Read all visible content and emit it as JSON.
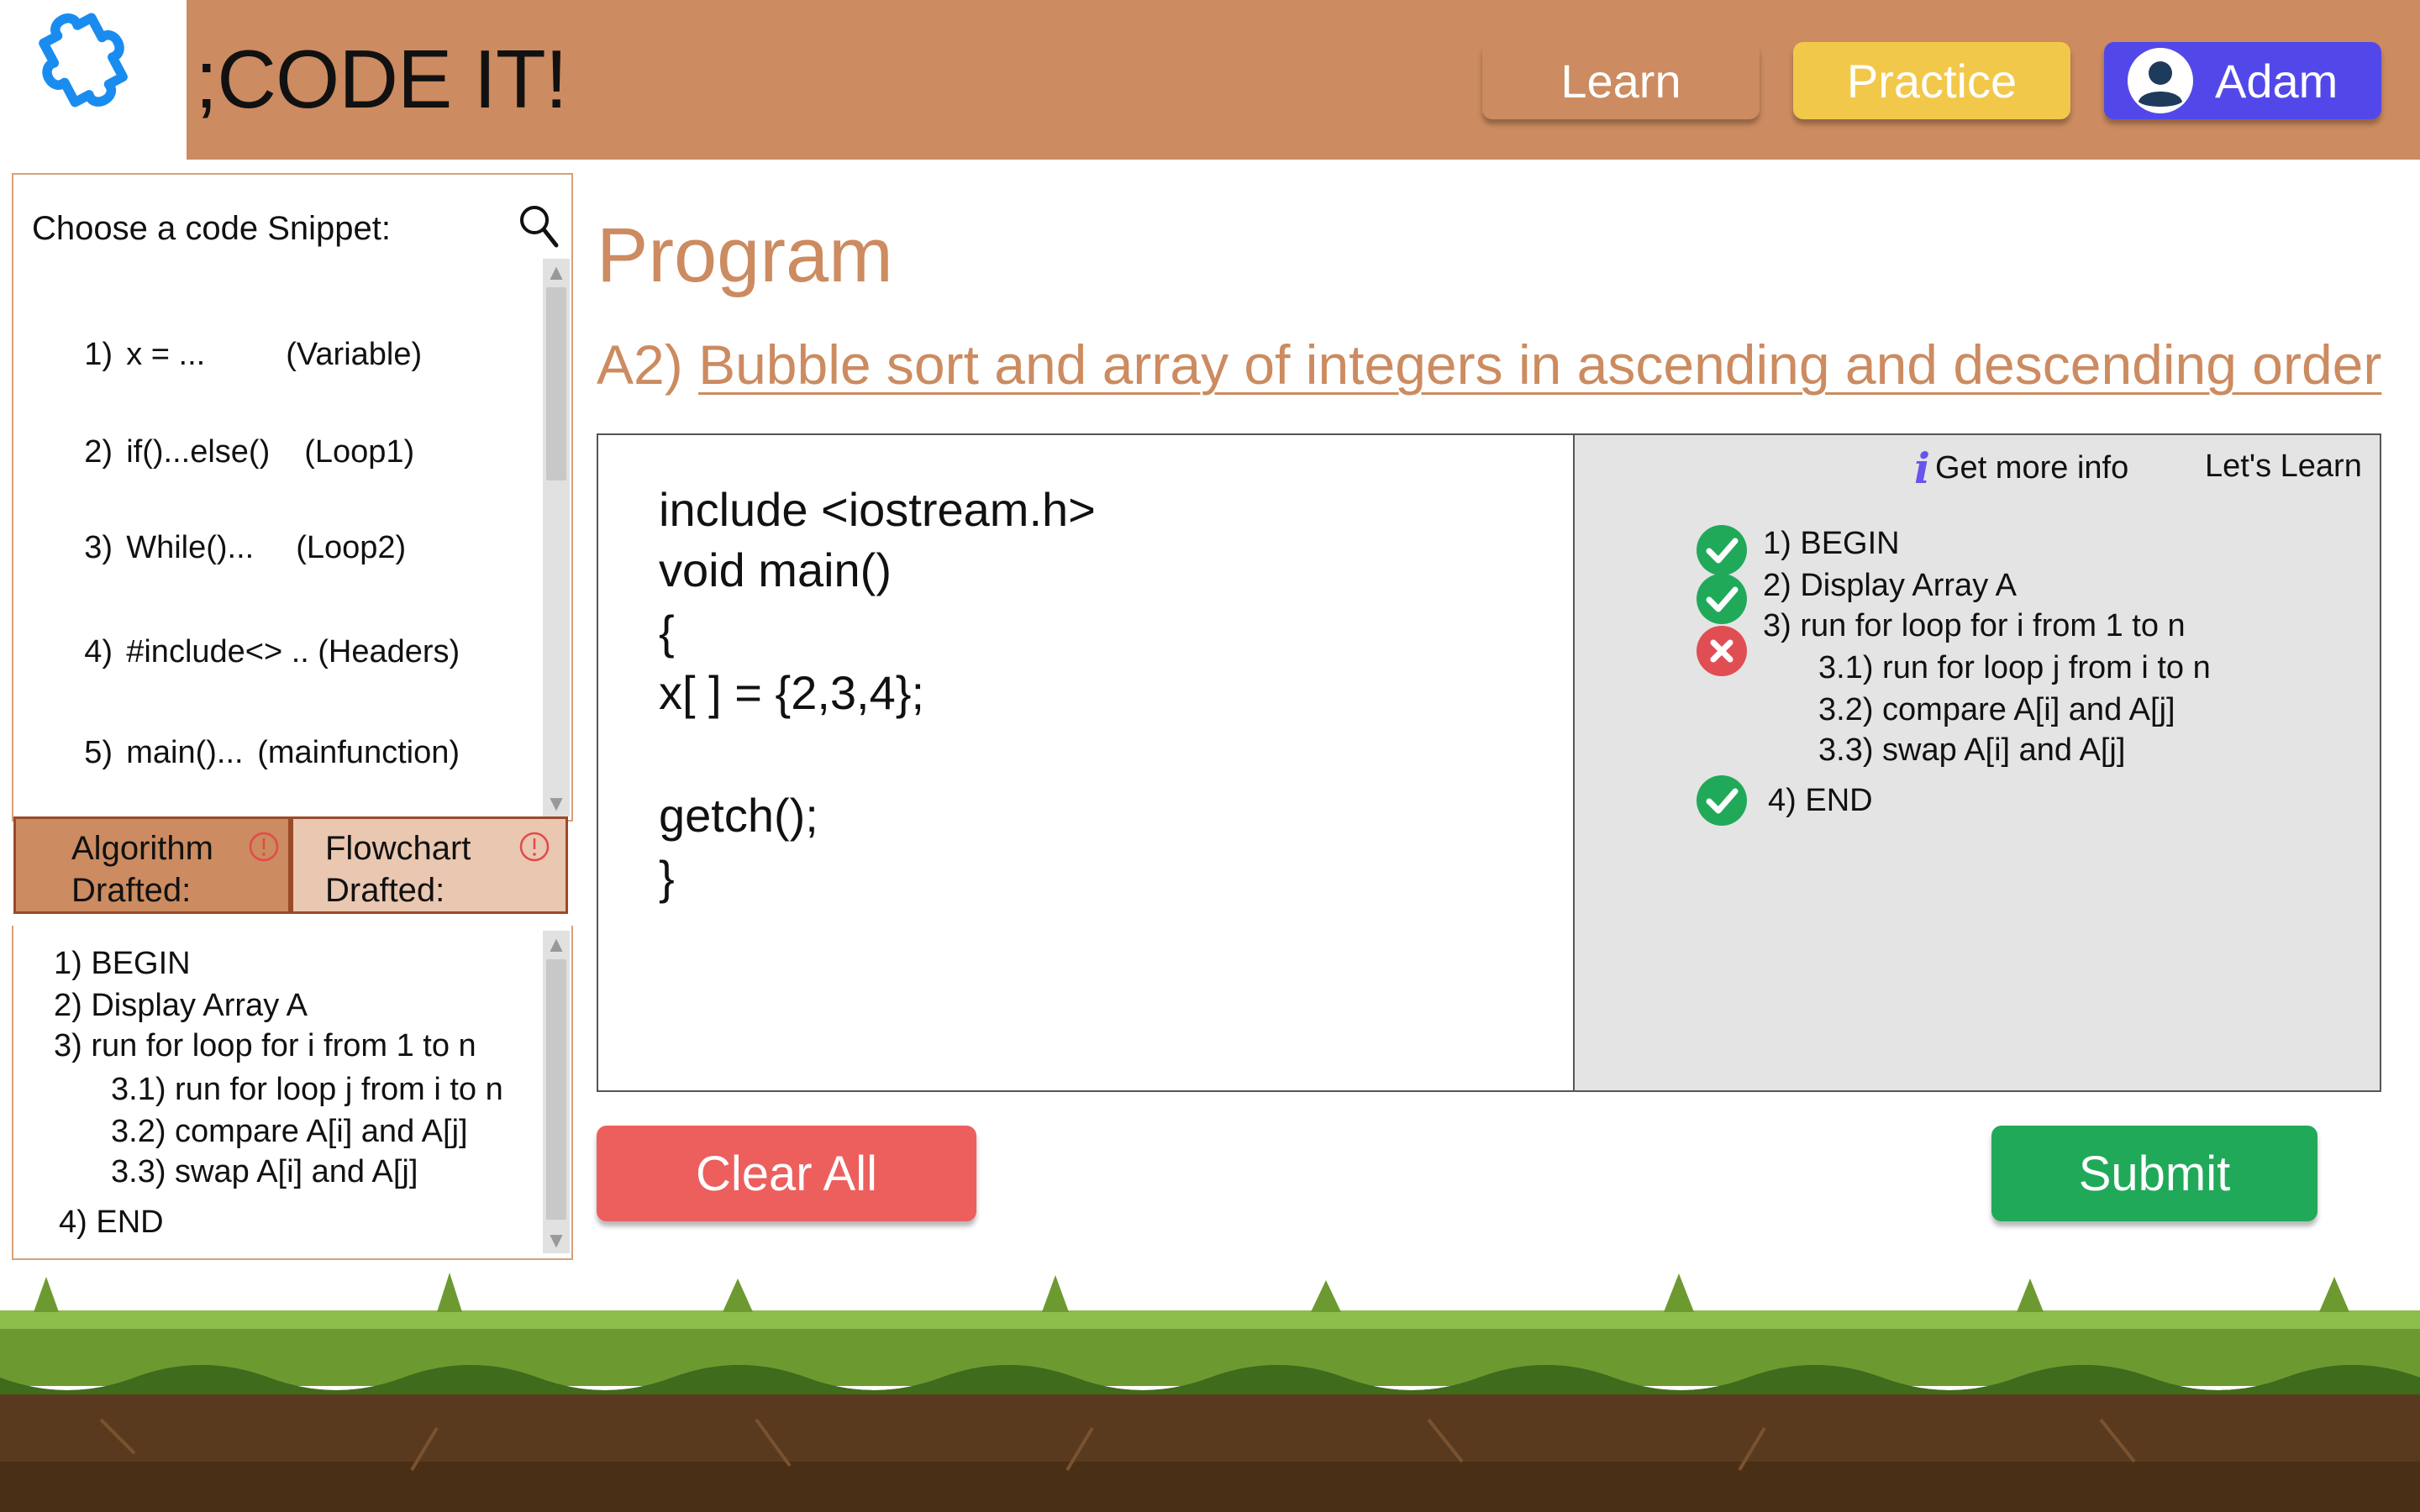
{
  "header": {
    "app_title": ";CODE IT!",
    "nav": {
      "learn": "Learn",
      "practice": "Practice",
      "user": "Adam"
    }
  },
  "sidebar": {
    "title": "Choose a code Snippet:",
    "snippets": [
      {
        "num": "1)",
        "code": "x = ...",
        "type": "(Variable)"
      },
      {
        "num": "2)",
        "code": "if()...else()",
        "type": "(Loop1)"
      },
      {
        "num": "3)",
        "code": "While()...",
        "type": "(Loop2)"
      },
      {
        "num": "4)",
        "code": "#include<> ..",
        "type": "(Headers)"
      },
      {
        "num": "5)",
        "code": "main()...",
        "type": "(mainfunction)"
      }
    ],
    "tabs": {
      "algorithm": "Algorithm\nDrafted:",
      "flowchart": "Flowchart\nDrafted:"
    },
    "algorithm": [
      "1) BEGIN",
      "2) Display Array A",
      "3) run for loop for i from 1 to n",
      "3.1) run for loop j from i to n",
      "3.2) compare A[i] and A[j]",
      "3.3) swap A[i] and A[j]",
      "4) END"
    ]
  },
  "main": {
    "heading": "Program",
    "task_id": "A2)",
    "task_title": "Bubble sort and array of integers in ascending and descending order",
    "code_lines": [
      "include <iostream.h>",
      "void main()",
      "{",
      "x[ ] = {2,3,4};",
      "",
      "getch();",
      "}"
    ],
    "checker": {
      "info_link": "Get more info",
      "learn_link": "Let's Learn",
      "steps": [
        "1) BEGIN",
        "2) Display Array A",
        "3) run for loop for i from 1 to n",
        "3.1) run for loop j from i to n",
        "3.2) compare A[i] and A[j]",
        "3.3) swap A[i] and A[j]",
        "4) END"
      ],
      "status_icons": [
        "check-icon",
        "check-icon",
        "cross-icon",
        "check-icon"
      ]
    },
    "buttons": {
      "clear": "Clear All",
      "submit": "Submit"
    }
  },
  "colors": {
    "header": "#cc8b60",
    "practice": "#f2c84b",
    "user": "#5248ea",
    "clear": "#ec5f5d",
    "submit": "#21a95a",
    "accent_text": "#cc8b60",
    "logo": "#1a8cf0"
  }
}
